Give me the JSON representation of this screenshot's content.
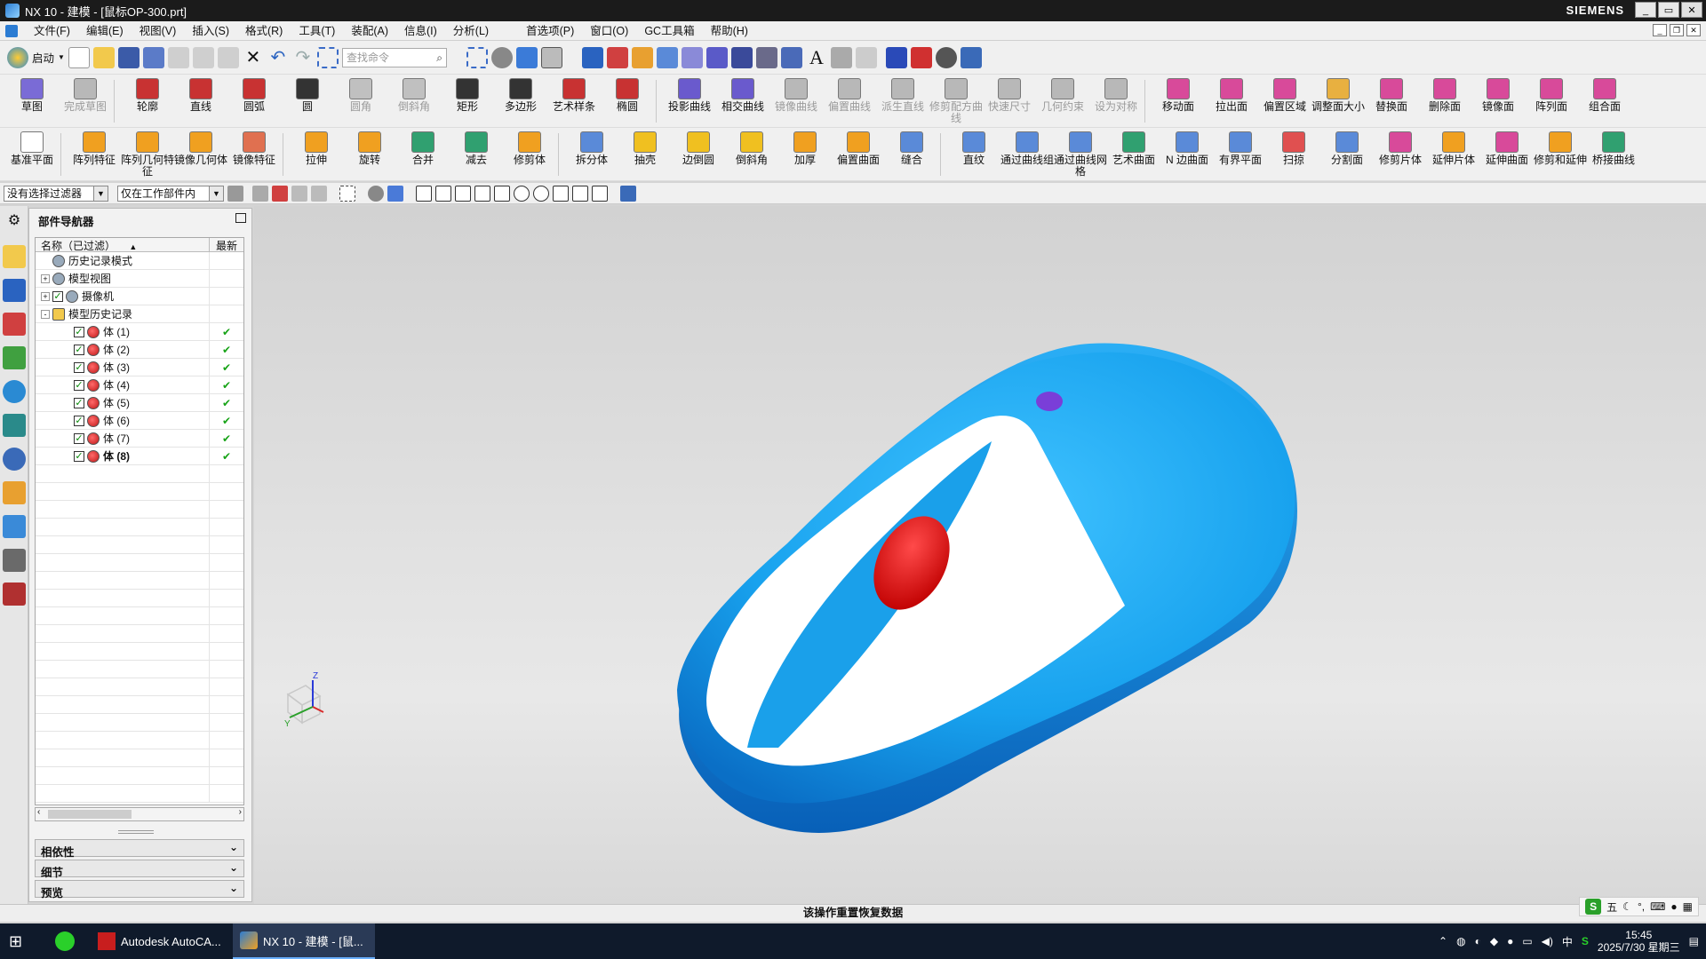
{
  "window": {
    "title": "NX 10 - 建模 - [鼠标OP-300.prt]",
    "brand": "SIEMENS",
    "buttons": [
      "_",
      "▭",
      "✕"
    ]
  },
  "menu": [
    "文件(F)",
    "编辑(E)",
    "视图(V)",
    "插入(S)",
    "格式(R)",
    "工具(T)",
    "装配(A)",
    "信息(I)",
    "分析(L)",
    "首选项(P)",
    "窗口(O)",
    "GC工具箱",
    "帮助(H)"
  ],
  "toolbar": {
    "start_label": "启动",
    "search_placeholder": "查找命令"
  },
  "ribbon_row1": [
    {
      "label": "草图",
      "enabled": true,
      "color": "#7a6bd6"
    },
    {
      "label": "完成草图",
      "enabled": false,
      "color": "#b8b8b8"
    },
    {
      "label": "轮廓",
      "enabled": true,
      "color": "#c83232"
    },
    {
      "label": "直线",
      "enabled": true,
      "color": "#c83232"
    },
    {
      "label": "圆弧",
      "enabled": true,
      "color": "#c83232"
    },
    {
      "label": "圆",
      "enabled": true,
      "color": "#333333"
    },
    {
      "label": "圆角",
      "enabled": false,
      "color": "#c0c0c0"
    },
    {
      "label": "倒斜角",
      "enabled": false,
      "color": "#c0c0c0"
    },
    {
      "label": "矩形",
      "enabled": true,
      "color": "#333333"
    },
    {
      "label": "多边形",
      "enabled": true,
      "color": "#333333"
    },
    {
      "label": "艺术样条",
      "enabled": true,
      "color": "#c83232"
    },
    {
      "label": "椭圆",
      "enabled": true,
      "color": "#c83232"
    },
    {
      "label": "投影曲线",
      "enabled": true,
      "color": "#6a5acd"
    },
    {
      "label": "相交曲线",
      "enabled": true,
      "color": "#6a5acd"
    },
    {
      "label": "镜像曲线",
      "enabled": false,
      "color": "#b8b8b8"
    },
    {
      "label": "偏置曲线",
      "enabled": false,
      "color": "#b8b8b8"
    },
    {
      "label": "派生直线",
      "enabled": false,
      "color": "#b8b8b8"
    },
    {
      "label": "修剪配方曲线",
      "enabled": false,
      "color": "#b8b8b8"
    },
    {
      "label": "快速尺寸",
      "enabled": false,
      "color": "#b8b8b8"
    },
    {
      "label": "几何约束",
      "enabled": false,
      "color": "#b8b8b8"
    },
    {
      "label": "设为对称",
      "enabled": false,
      "color": "#b8b8b8"
    },
    {
      "label": "移动面",
      "enabled": true,
      "color": "#d84a9a"
    },
    {
      "label": "拉出面",
      "enabled": true,
      "color": "#d84a9a"
    },
    {
      "label": "偏置区域",
      "enabled": true,
      "color": "#d84a9a"
    },
    {
      "label": "调整面大小",
      "enabled": true,
      "color": "#e8b040"
    },
    {
      "label": "替换面",
      "enabled": true,
      "color": "#d84a9a"
    },
    {
      "label": "删除面",
      "enabled": true,
      "color": "#d84a9a"
    },
    {
      "label": "镜像面",
      "enabled": true,
      "color": "#d84a9a"
    },
    {
      "label": "阵列面",
      "enabled": true,
      "color": "#d84a9a"
    },
    {
      "label": "组合面",
      "enabled": true,
      "color": "#d84a9a"
    }
  ],
  "ribbon_row2": [
    {
      "label": "基准平面",
      "color": "#ffffff"
    },
    {
      "label": "阵列特征",
      "color": "#f0a020"
    },
    {
      "label": "阵列几何特征",
      "color": "#f0a020"
    },
    {
      "label": "镜像几何体",
      "color": "#f0a020"
    },
    {
      "label": "镜像特征",
      "color": "#e07050"
    },
    {
      "label": "拉伸",
      "color": "#f0a020"
    },
    {
      "label": "旋转",
      "color": "#f0a020"
    },
    {
      "label": "合并",
      "color": "#30a070"
    },
    {
      "label": "减去",
      "color": "#30a070"
    },
    {
      "label": "修剪体",
      "color": "#f0a020"
    },
    {
      "label": "拆分体",
      "color": "#5a8ad8"
    },
    {
      "label": "抽壳",
      "color": "#f0c020"
    },
    {
      "label": "边倒圆",
      "color": "#f0c020"
    },
    {
      "label": "倒斜角",
      "color": "#f0c020"
    },
    {
      "label": "加厚",
      "color": "#f0a020"
    },
    {
      "label": "偏置曲面",
      "color": "#f0a020"
    },
    {
      "label": "缝合",
      "color": "#5a8ad8"
    },
    {
      "label": "直纹",
      "color": "#5a8ad8"
    },
    {
      "label": "通过曲线组",
      "color": "#5a8ad8"
    },
    {
      "label": "通过曲线网格",
      "color": "#5a8ad8"
    },
    {
      "label": "艺术曲面",
      "color": "#30a070"
    },
    {
      "label": "N 边曲面",
      "color": "#5a8ad8"
    },
    {
      "label": "有界平面",
      "color": "#5a8ad8"
    },
    {
      "label": "扫掠",
      "color": "#e05050"
    },
    {
      "label": "分割面",
      "color": "#5a8ad8"
    },
    {
      "label": "修剪片体",
      "color": "#d84a9a"
    },
    {
      "label": "延伸片体",
      "color": "#f0a020"
    },
    {
      "label": "延伸曲面",
      "color": "#d84a9a"
    },
    {
      "label": "修剪和延伸",
      "color": "#f0a020"
    },
    {
      "label": "桥接曲线",
      "color": "#30a070"
    }
  ],
  "filter": {
    "type_filter": "没有选择过滤器",
    "scope": "仅在工作部件内"
  },
  "navigator": {
    "title": "部件导航器",
    "col_name": "名称（已过滤）",
    "col_latest": "最新",
    "rows": [
      {
        "label": "历史记录模式",
        "level": 1,
        "expand": "",
        "check": false,
        "latest": ""
      },
      {
        "label": "模型视图",
        "level": 1,
        "expand": "+",
        "check": false,
        "latest": ""
      },
      {
        "label": "摄像机",
        "level": 1,
        "expand": "+",
        "check": true,
        "latest": ""
      },
      {
        "label": "模型历史记录",
        "level": 1,
        "expand": "-",
        "check": false,
        "latest": ""
      },
      {
        "label": "体 (1)",
        "level": 2,
        "expand": "",
        "check": true,
        "latest": "✔"
      },
      {
        "label": "体 (2)",
        "level": 2,
        "expand": "",
        "check": true,
        "latest": "✔"
      },
      {
        "label": "体 (3)",
        "level": 2,
        "expand": "",
        "check": true,
        "latest": "✔"
      },
      {
        "label": "体 (4)",
        "level": 2,
        "expand": "",
        "check": true,
        "latest": "✔"
      },
      {
        "label": "体 (5)",
        "level": 2,
        "expand": "",
        "check": true,
        "latest": "✔"
      },
      {
        "label": "体 (6)",
        "level": 2,
        "expand": "",
        "check": true,
        "latest": "✔"
      },
      {
        "label": "体 (7)",
        "level": 2,
        "expand": "",
        "check": true,
        "latest": "✔"
      },
      {
        "label": "体 (8)",
        "level": 2,
        "expand": "",
        "check": true,
        "latest": "✔"
      }
    ],
    "panels": [
      "相依性",
      "细节",
      "预览"
    ]
  },
  "viewport": {
    "triad": {
      "z": "Z",
      "y": "Y"
    }
  },
  "status": "该操作重置恢复数据",
  "taskbar": {
    "apps": [
      "Autodesk AutoCA...",
      "NX 10 - 建模 - [鼠..."
    ],
    "time": "15:45",
    "date": "2025/7/30 星期三",
    "ime": "五",
    "tray_lang": "中"
  }
}
